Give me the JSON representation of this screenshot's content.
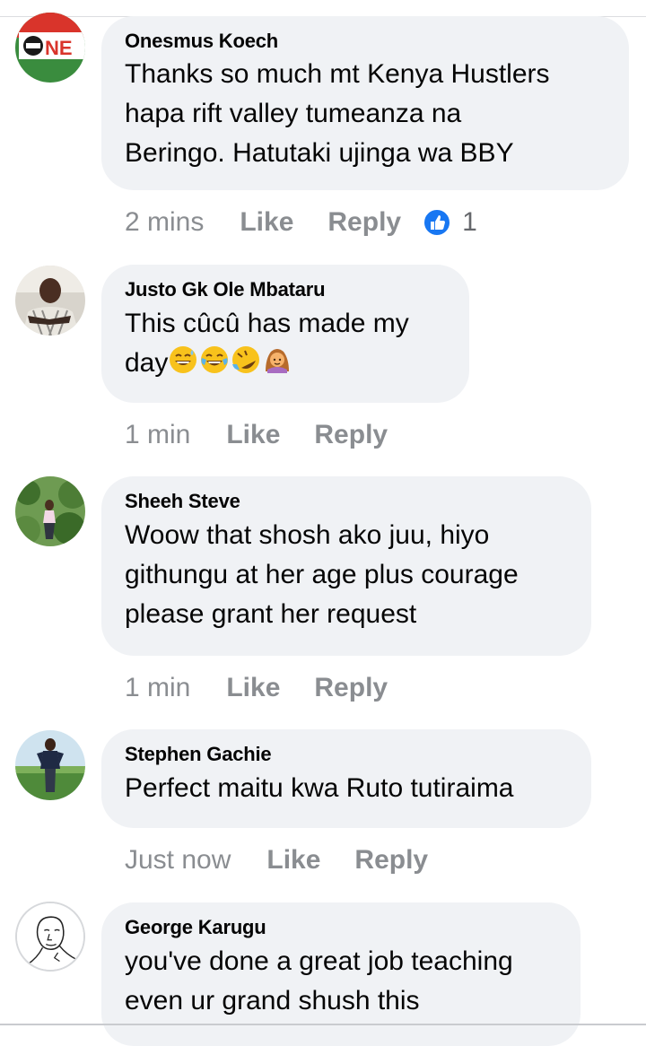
{
  "comments": [
    {
      "author": "Onesmus Koech",
      "lines": [
        "Thanks so much mt Kenya Hustlers",
        "hapa rift valley tumeanza na",
        "Beringo. Hatutaki ujinga wa BBY"
      ],
      "time": "2 mins",
      "like_label": "Like",
      "reply_label": "Reply",
      "reaction_count": "1",
      "avatar_text": "NE"
    },
    {
      "author": "Justo Gk Ole Mbataru",
      "lines": [
        "This cûcû has made my",
        "day"
      ],
      "emojis": [
        "sweat-smile-emoji",
        "joy-emoji",
        "rofl-emoji",
        "woman-gesturing-ok-emoji"
      ],
      "time": "1 min",
      "like_label": "Like",
      "reply_label": "Reply"
    },
    {
      "author": "Sheeh Steve",
      "lines": [
        "Woow that shosh ako juu, hiyo",
        "githungu at her age plus courage",
        "please grant her request"
      ],
      "time": "1 min",
      "like_label": "Like",
      "reply_label": "Reply"
    },
    {
      "author": "Stephen Gachie",
      "lines": [
        "Perfect maitu kwa Ruto tutiraima"
      ],
      "time": "Just now",
      "like_label": "Like",
      "reply_label": "Reply"
    },
    {
      "author": "George Karugu",
      "lines": [
        "you've done a great job teaching",
        "even ur grand shush this"
      ]
    }
  ],
  "colors": {
    "bubble": "#f0f2f5",
    "meta": "#8a8d91",
    "like_blue": "#1877f2"
  }
}
